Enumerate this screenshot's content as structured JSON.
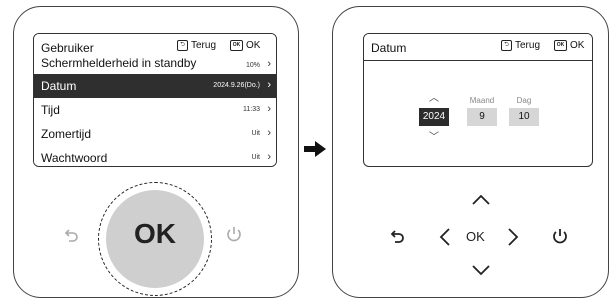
{
  "left_panel": {
    "title": "Gebruiker",
    "back_label": "Terug",
    "ok_label": "OK",
    "rows": [
      {
        "label": "Schermhelderheid in standby",
        "value": "10%",
        "selected": false
      },
      {
        "label": "Datum",
        "value": "2024.9.26(Do.)",
        "selected": true
      },
      {
        "label": "Tijd",
        "value": "11:33",
        "selected": false
      },
      {
        "label": "Zomertijd",
        "value": "Uit",
        "selected": false
      },
      {
        "label": "Wachtwoord",
        "value": "Uit",
        "selected": false
      }
    ],
    "knob_label": "OK",
    "icons": {
      "back": "back-arrow-icon",
      "power": "power-icon"
    }
  },
  "arrow_between": "right-arrow-icon",
  "right_panel": {
    "title": "Datum",
    "back_label": "Terug",
    "ok_label": "OK",
    "date": {
      "year": {
        "header": "",
        "value": "2024",
        "active": true
      },
      "month": {
        "header": "Maand",
        "value": "9",
        "active": false
      },
      "day": {
        "header": "Dag",
        "value": "10",
        "active": false
      }
    },
    "dpad_center_label": "OK",
    "icons": {
      "up": "chevron-up-icon",
      "down": "chevron-down-icon",
      "left": "chevron-left-icon",
      "right": "chevron-right-icon",
      "back": "back-arrow-icon",
      "power": "power-icon"
    }
  }
}
